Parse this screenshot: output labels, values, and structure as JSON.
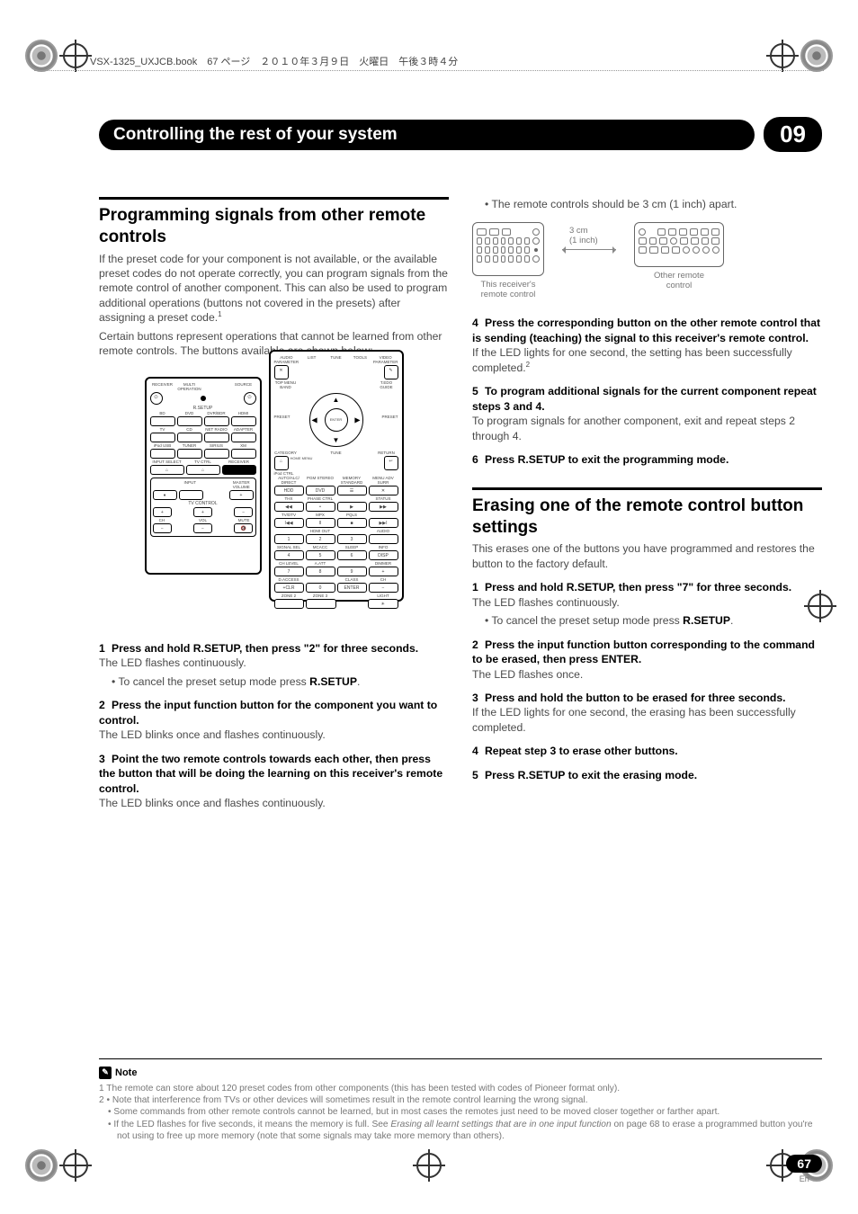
{
  "header_info": "VSX-1325_UXJCB.book　67 ページ　２０１０年３月９日　火曜日　午後３時４分",
  "chapter": {
    "title": "Controlling the rest of your system",
    "number": "09"
  },
  "left": {
    "h2": "Programming signals from other remote controls",
    "p1": "If the preset code for your component is not available, or the available preset codes do not operate correctly, you can program signals from the remote control of another component. This can also be used to program additional operations (buttons not covered in the presets) after assigning a preset code.",
    "sup1": "1",
    "p2": "Certain buttons represent operations that cannot be learned from other remote controls. The buttons available are shown below:",
    "s1": "Press and hold R.SETUP, then press \"2\" for three seconds.",
    "s1sub": "The LED flashes continuously.",
    "s1b": "To cancel the preset setup mode press ",
    "s1b_bold": "R.SETUP",
    "s2": "Press the input function button for the component you want to control.",
    "s2sub": "The LED blinks once and flashes continuously.",
    "s3": "Point the two remote controls towards each other, then press the button that will be doing the learning on this receiver's remote control.",
    "s3sub": "The LED blinks once and flashes continuously."
  },
  "right": {
    "b1": "The remote controls should be 3 cm (1 inch) apart.",
    "fig": {
      "dim1": "3 cm",
      "dim2": "(1 inch)",
      "cap1a": "This receiver's",
      "cap1b": "remote control",
      "cap2a": "Other remote",
      "cap2b": "control"
    },
    "s4": "Press the corresponding button on the other remote control that is sending (teaching) the signal to this receiver's remote control.",
    "s4sub": "If the LED lights for one second, the setting has been successfully completed.",
    "sup2": "2",
    "s5": "To program additional signals for the current component repeat steps 3 and 4.",
    "s5sub": "To program signals for another component, exit and repeat steps 2 through 4.",
    "s6": "Press R.SETUP to exit the programming mode.",
    "h2b": "Erasing one of the remote control button settings",
    "p3": "This erases one of the buttons you have programmed and restores the button to the factory default.",
    "e1": "Press and hold R.SETUP, then press \"7\" for three seconds.",
    "e1sub": "The LED flashes continuously.",
    "e1b": "To cancel the preset setup mode press ",
    "e1b_bold": "R.SETUP",
    "e2": "Press the input function button corresponding to the command to be erased, then press ENTER.",
    "e2sub": "The LED flashes once.",
    "e3": "Press and hold the button to be erased for three seconds.",
    "e3sub": "If the LED lights for one second, the erasing has been successfully completed.",
    "e4": "Repeat step 3 to erase other buttons.",
    "e5": "Press R.SETUP to exit the erasing mode."
  },
  "remote_labels": {
    "row1": [
      "RECEIVER",
      "MULTI OPERATION",
      "",
      "SOURCE"
    ],
    "rsetup": "R.SETUP",
    "row2": [
      "BD",
      "DVD",
      "DVR/BDR",
      "HDMI"
    ],
    "row3": [
      "TV",
      "CD",
      "NET RADIO",
      "ADAPTER"
    ],
    "row4": [
      "iPod USB",
      "TUNER",
      "SIRIUS",
      "XM"
    ],
    "row5": [
      "INPUT SELECT",
      "TV CTRL",
      "RECEIVER"
    ],
    "input": "INPUT",
    "master": "MASTER VOLUME",
    "tvcontrol": "TV CONTROL",
    "ch": "CH",
    "vol": "VOL",
    "mute": "MUTE",
    "audio_param": "AUDIO PARAMETER",
    "video_param": "VIDEO PARAMETER",
    "list": "LIST",
    "tune": "TUNE",
    "tools": "TOOLS",
    "topmenu": "TOP MENU",
    "band": "BAND",
    "tedo": "T.EDO",
    "guide": "GUIDE",
    "preset": "PRESET",
    "enter": "ENTER",
    "category": "CATEGORY",
    "return": "RETURN",
    "homemenu": "HOME MENU",
    "ipodctrl": "iPod CTRL",
    "r2a": [
      "AUTO/ALC/ DIRECT",
      "PGM STEREO",
      "MEMORY STANDARD",
      "MENU ADV SURR"
    ],
    "r2b": [
      "HDD",
      "DVD"
    ],
    "r2c": [
      "THX",
      "PHASE CTRL",
      "STATUS"
    ],
    "r2d": [
      "TV/DTV",
      "MPX",
      "PQLS"
    ],
    "hdmiout": "HDMI OUT",
    "audio": "AUDIO",
    "nums1": [
      "1",
      "2",
      "3"
    ],
    "r2e": [
      "SIGNAL SEL",
      "MCACC",
      "SLEEP",
      "INFO"
    ],
    "nums2": [
      "4",
      "5",
      "6",
      "DISP"
    ],
    "r2f": [
      "CH LEVEL",
      "A.ATT",
      "",
      "DIMMER"
    ],
    "nums3": [
      "7",
      "8",
      "9",
      "+"
    ],
    "r2g": [
      "D.ACCESS",
      "",
      "CLASS",
      "CH"
    ],
    "nums4": [
      "+CLR",
      "0",
      "ENTER",
      "−"
    ],
    "zones": [
      "ZONE 2",
      "ZONE 3",
      "",
      "LIGHT"
    ]
  },
  "notes": {
    "label": "Note",
    "n1": "1  The remote can store about 120 preset codes from other components (this has been tested with codes of Pioneer format only).",
    "n2a": "2 • Note that interference from TVs or other devices will sometimes result in the remote control learning the wrong signal.",
    "n2b": "• Some commands from other remote controls cannot be learned, but in most cases the remotes just need to be moved closer together or farther apart.",
    "n2c_a": "• If the LED flashes for five seconds, it means the memory is full. See ",
    "n2c_i": "Erasing all learnt settings that are in one input function",
    "n2c_b": " on page 68 to erase a programmed button you're not using to free up more memory (note that some signals may take more memory than others)."
  },
  "page": {
    "num": "67",
    "lang": "En"
  }
}
